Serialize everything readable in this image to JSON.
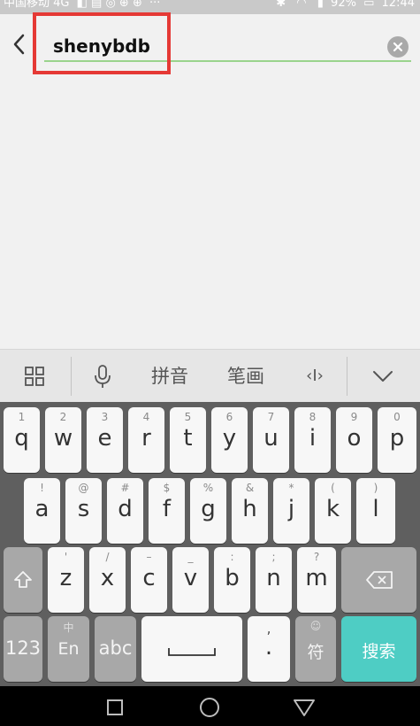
{
  "status_bar": {
    "carrier": "中国移动 4G",
    "battery": "92%",
    "time": "12:44",
    "dots": "···"
  },
  "search": {
    "value": "shenybdb"
  },
  "ime_toolbar": {
    "pinyin": "拼音",
    "stroke": "笔画",
    "cursor": "‹I›"
  },
  "keyboard": {
    "row1": [
      {
        "sub": "1",
        "key": "q"
      },
      {
        "sub": "2",
        "key": "w"
      },
      {
        "sub": "3",
        "key": "e"
      },
      {
        "sub": "4",
        "key": "r"
      },
      {
        "sub": "5",
        "key": "t"
      },
      {
        "sub": "6",
        "key": "y"
      },
      {
        "sub": "7",
        "key": "u"
      },
      {
        "sub": "8",
        "key": "i"
      },
      {
        "sub": "9",
        "key": "o"
      },
      {
        "sub": "0",
        "key": "p"
      }
    ],
    "row2": [
      {
        "sub": "!",
        "key": "a"
      },
      {
        "sub": "@",
        "key": "s"
      },
      {
        "sub": "#",
        "key": "d"
      },
      {
        "sub": "$",
        "key": "f"
      },
      {
        "sub": "%",
        "key": "g"
      },
      {
        "sub": "&",
        "key": "h"
      },
      {
        "sub": "*",
        "key": "j"
      },
      {
        "sub": "(",
        "key": "k"
      },
      {
        "sub": ")",
        "key": "l"
      }
    ],
    "row3": [
      {
        "sub": "'",
        "key": "z"
      },
      {
        "sub": "/",
        "key": "x"
      },
      {
        "sub": "–",
        "key": "c"
      },
      {
        "sub": "_",
        "key": "v"
      },
      {
        "sub": ":",
        "key": "b"
      },
      {
        "sub": ";",
        "key": "n"
      },
      {
        "sub": "?",
        "key": "m"
      }
    ],
    "num_key": "123",
    "lang_sub": "中",
    "lang_key": "En",
    "abc_key": "abc",
    "comma_sub": ",",
    "period_key": ".",
    "symbol_key": "符",
    "search_key": "搜索"
  }
}
